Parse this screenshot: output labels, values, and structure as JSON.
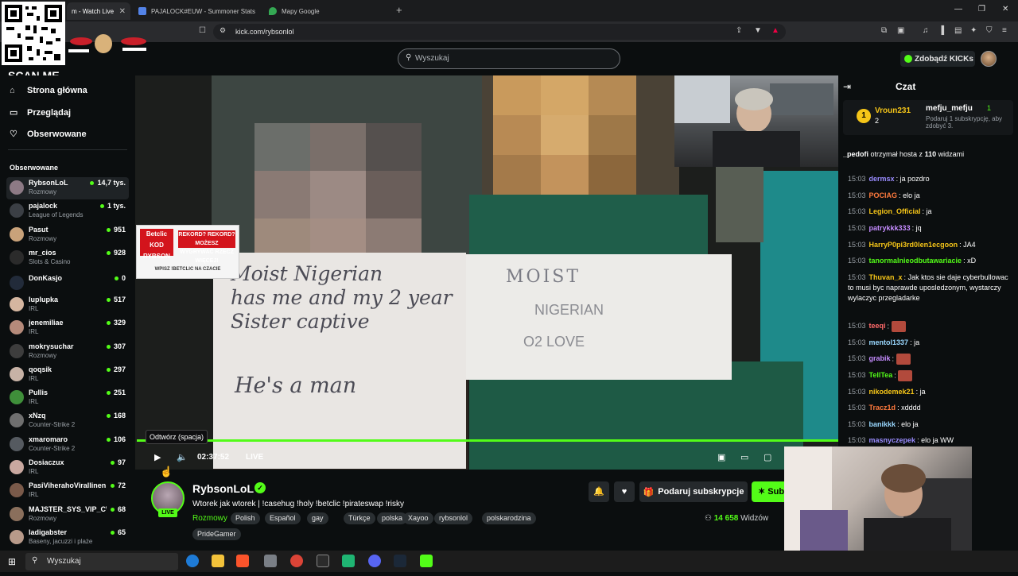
{
  "browser": {
    "tabs": [
      {
        "label": "m - Watch Live",
        "active": true
      },
      {
        "label": "PAJALOCK#EUW - Summoner Stats"
      },
      {
        "label": "Mapy Google"
      }
    ],
    "url": "kick.com/rybsonlol"
  },
  "overlay": {
    "scan_me": "SCAN ME"
  },
  "header": {
    "search_placeholder": "Wyszukaj",
    "kicks_button": "Zdobądź KICKs"
  },
  "sidebar": {
    "nav": [
      {
        "label": "Strona główna",
        "icon": "home-icon"
      },
      {
        "label": "Przeglądaj",
        "icon": "browse-icon"
      },
      {
        "label": "Obserwowane",
        "icon": "heart-icon"
      }
    ],
    "following_heading": "Obserwowane",
    "channels": [
      {
        "name": "RybsonLoL",
        "category": "Rozmowy",
        "viewers": "14,7 tys.",
        "color": "#8d7a85",
        "selected": true
      },
      {
        "name": "pajalock",
        "category": "League of Legends",
        "viewers": "1 tys.",
        "color": "#3b3f45"
      },
      {
        "name": "Pasut",
        "category": "Rozmowy",
        "viewers": "951",
        "color": "#c9a27a"
      },
      {
        "name": "mr_cios",
        "category": "Slots & Casino",
        "viewers": "928",
        "color": "#2b2b2b"
      },
      {
        "name": "DonKasjo",
        "category": "",
        "viewers": "0",
        "color": "#222b3a"
      },
      {
        "name": "luplupka",
        "category": "IRL",
        "viewers": "517",
        "color": "#d5b6a0"
      },
      {
        "name": "jenemiliae",
        "category": "IRL",
        "viewers": "329",
        "color": "#b58a7a"
      },
      {
        "name": "mokrysuchar",
        "category": "Rozmowy",
        "viewers": "307",
        "color": "#3d3d3d"
      },
      {
        "name": "qoqsik",
        "category": "IRL",
        "viewers": "297",
        "color": "#c7b2a6"
      },
      {
        "name": "Pullis",
        "category": "IRL",
        "viewers": "251",
        "color": "#3f8f3a"
      },
      {
        "name": "xNzq",
        "category": "Counter-Strike 2",
        "viewers": "168",
        "color": "#6f6f6f"
      },
      {
        "name": "xmaromaro",
        "category": "Counter-Strike 2",
        "viewers": "106",
        "color": "#555a60"
      },
      {
        "name": "Dosiaczux",
        "category": "IRL",
        "viewers": "97",
        "color": "#c9a8a0"
      },
      {
        "name": "PasiViherahoVirallinen",
        "category": "IRL",
        "viewers": "72",
        "color": "#7a5a4a"
      },
      {
        "name": "MAJSTER_SYS_VIP_CWEL",
        "category": "Rozmowy",
        "viewers": "68",
        "color": "#8a6f5c"
      },
      {
        "name": "ladigabster",
        "category": "Baseny, jacuzzi i plaże",
        "viewers": "65",
        "color": "#b89a8a"
      }
    ]
  },
  "video": {
    "sign1_line1": "Moist Nigerian",
    "sign1_line2": "has me and my 2 year",
    "sign1_line3": "Sister captive",
    "sign1_line4": "He's a  man",
    "sign2_line1": "MOIST",
    "sign2_line2": "NIGERIAN",
    "sign2_line3": "O2 LOVE",
    "betclic": {
      "brand": "Betclic",
      "headline": "REKORD? REKORD? MOŻESZ WYGRYWAĆ RZECZ WIĘCEJ!",
      "code_label": "KOD RYBSON",
      "footer": "WPISZ !BETCLIC NA CZACIE"
    }
  },
  "player": {
    "tooltip": "Odtwórz (spacja)",
    "time": "02:37:52",
    "live": "LIVE"
  },
  "channel": {
    "name": "RybsonLoL",
    "live_badge": "LIVE",
    "title": "Wtorek jak wtorek | !casehug !holy !betclic !pirateswap !risky",
    "category": "Rozmowy",
    "tags": [
      "Polish",
      "Español",
      "gay",
      "Türkçe",
      "polska",
      "Xayoo",
      "rybsonlol",
      "polskarodzina",
      "PrideGamer"
    ],
    "subscribe_label": "Podaruj subskrypcje",
    "sub_label": "Sub",
    "viewers_count": "14 658",
    "viewers_label": "Widzów"
  },
  "chat": {
    "title": "Czat",
    "pinned": {
      "rank": "1",
      "user1": "Vroun231",
      "count1": "2",
      "user2": "mefju_mefju",
      "count2": "1",
      "subtext": "Podaruj 1 subskrypcję, aby zdobyć 3."
    },
    "host_user": "_pedofi",
    "host_text": "otrzymał hosta z",
    "host_count": "110",
    "host_suffix": "widzami",
    "messages": [
      {
        "time": "15:03",
        "user": "dermsx",
        "color": "#9a8cff",
        "text": "ja pozdro"
      },
      {
        "time": "15:03",
        "user": "POCIAG",
        "color": "#ff7a3d",
        "text": "elo ja"
      },
      {
        "time": "15:03",
        "user": "Legion_Official",
        "color": "#f5c518",
        "text": "ja"
      },
      {
        "time": "15:03",
        "user": "patrykkk333",
        "color": "#c58cff",
        "text": "jq"
      },
      {
        "time": "15:03",
        "user": "HarryP0pi3rd0len1ecgoon",
        "color": "#f5c518",
        "text": "JA4"
      },
      {
        "time": "15:03",
        "user": "tanormalnieodbutawariacie",
        "color": "#53fc18",
        "text": "xD"
      },
      {
        "time": "15:03",
        "user": "Thuvan_x",
        "color": "#f5c518",
        "text": "Jak ktos sie daje cyberbullowac to musi byc naprawde uposledzonym, wystarczy wylaczyc przegladarke"
      },
      {
        "time": "15:03",
        "user": "teeqi",
        "color": "#ff6a6a",
        "text": ""
      },
      {
        "time": "15:03",
        "user": "mentol1337",
        "color": "#9ad8ff",
        "text": "ja"
      },
      {
        "time": "15:03",
        "user": "grabik",
        "color": "#c58cff",
        "text": ""
      },
      {
        "time": "15:03",
        "user": "TellTea",
        "color": "#53fc18",
        "text": ""
      },
      {
        "time": "15:03",
        "user": "nikodemek21",
        "color": "#f5c518",
        "text": "ja"
      },
      {
        "time": "15:03",
        "user": "Tracz1d",
        "color": "#ff7a3d",
        "text": "xdddd"
      },
      {
        "time": "15:03",
        "user": "banikkk",
        "color": "#9ad8ff",
        "text": "elo ja"
      },
      {
        "time": "15:03",
        "user": "masnyczepek",
        "color": "#9a8cff",
        "text": "elo ja WW"
      }
    ]
  },
  "taskbar": {
    "search": "Wyszukaj"
  }
}
